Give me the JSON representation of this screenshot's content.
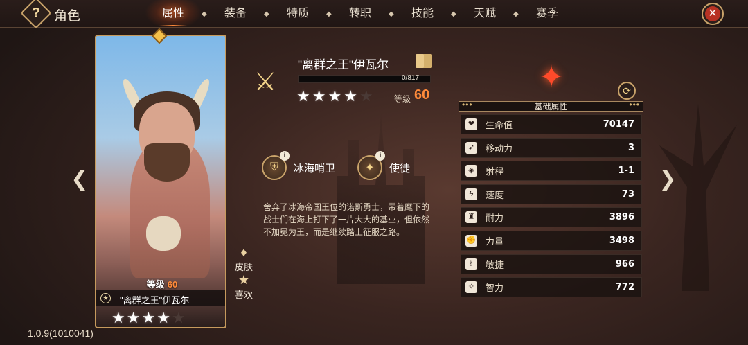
{
  "header": {
    "title": "角色",
    "help_icon": "?",
    "close_icon": "✕",
    "tabs": [
      "属性",
      "装备",
      "特质",
      "转职",
      "技能",
      "天赋",
      "赛季"
    ],
    "active_tab": "属性"
  },
  "card": {
    "level_label": "等级",
    "level_value": "60",
    "name": "\"离群之王\"伊瓦尔",
    "star_badge": "★",
    "stars": [
      "★",
      "★",
      "★",
      "★",
      "★"
    ],
    "stars_filled": 4
  },
  "side_buttons": {
    "skin_label": "皮肤",
    "emote_label": "喜欢"
  },
  "hero": {
    "class_icon": "⚔",
    "title": "\"离群之王\"伊瓦尔",
    "exp_text": "0/817",
    "exp_fraction": 0,
    "stars": [
      "★",
      "★",
      "★",
      "★",
      "★"
    ],
    "stars_filled": 4,
    "level_label": "等级",
    "level_value": "60"
  },
  "traits": [
    {
      "icon": "⛨",
      "info": "i",
      "label": "冰海哨卫"
    },
    {
      "icon": "✦",
      "info": "i",
      "label": "使徒"
    }
  ],
  "lore": "舍弃了冰海帝国王位的诺斯勇士，带着麾下的战士们在海上打下了一片大大的基业，但依然不加冕为王，而是继续踏上征服之路。",
  "attributes": {
    "emblem": "✦",
    "refresh_icon": "⟳",
    "header": "基础属性",
    "dots": "•••",
    "rows": [
      {
        "icon": "❤",
        "name": "生命值",
        "value": "70147"
      },
      {
        "icon": "➶",
        "name": "移动力",
        "value": "3"
      },
      {
        "icon": "◈",
        "name": "射程",
        "value": "1-1"
      },
      {
        "icon": "ϟ",
        "name": "速度",
        "value": "73"
      },
      {
        "icon": "♜",
        "name": "耐力",
        "value": "3896"
      },
      {
        "icon": "✊",
        "name": "力量",
        "value": "3498"
      },
      {
        "icon": "✌",
        "name": "敏捷",
        "value": "966"
      },
      {
        "icon": "✧",
        "name": "智力",
        "value": "772"
      }
    ]
  },
  "nav": {
    "left": "❮",
    "right": "❯"
  },
  "version": "1.0.9(1010041)",
  "colors": {
    "accent": "#ff8a3a",
    "gold": "#c9a36a",
    "emblem": "#ff4a2a"
  }
}
